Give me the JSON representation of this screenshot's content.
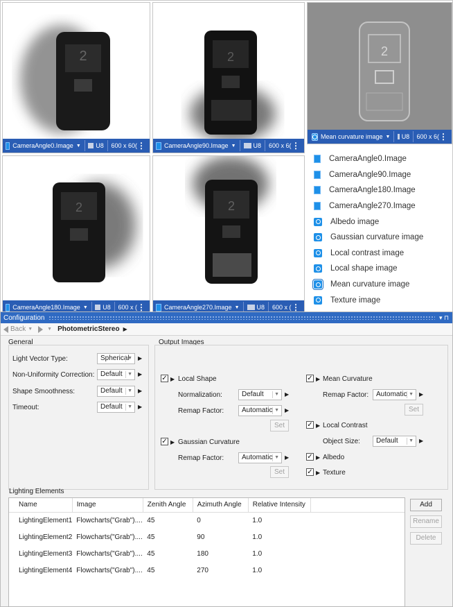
{
  "panes": [
    {
      "image": "CameraAngle0.Image",
      "type": "U8",
      "size": "600 x 60("
    },
    {
      "image": "CameraAngle90.Image",
      "type": "U8",
      "size": "600 x 6("
    },
    {
      "image": "Mean curvature image",
      "type": "U8",
      "size": "600 x 6("
    },
    {
      "image": "CameraAngle180.Image",
      "type": "U8",
      "size": "600 x ("
    },
    {
      "image": "CameraAngle270.Image",
      "type": "U8",
      "size": "600 x ("
    }
  ],
  "image_list": [
    {
      "label": "CameraAngle0.Image",
      "icon": "camera-image-icon"
    },
    {
      "label": "CameraAngle90.Image",
      "icon": "camera-image-icon"
    },
    {
      "label": "CameraAngle180.Image",
      "icon": "camera-image-icon"
    },
    {
      "label": "CameraAngle270.Image",
      "icon": "camera-image-icon"
    },
    {
      "label": "Albedo image",
      "icon": "computed-image-icon"
    },
    {
      "label": "Gaussian curvature image",
      "icon": "computed-image-icon"
    },
    {
      "label": "Local contrast image",
      "icon": "computed-image-icon"
    },
    {
      "label": "Local shape image",
      "icon": "computed-image-icon"
    },
    {
      "label": "Mean curvature image",
      "icon": "computed-image-icon",
      "selected": true
    },
    {
      "label": "Texture image",
      "icon": "computed-image-icon"
    }
  ],
  "config": {
    "title": "Configuration",
    "title_controls": "▾ ⊓",
    "nav": {
      "back": "Back",
      "breadcrumb": "PhotometricStereo"
    },
    "general": {
      "title": "General",
      "fields": [
        {
          "label": "Light Vector Type:",
          "value": "Spherical"
        },
        {
          "label": "Non-Uniformity Correction:",
          "value": "Default"
        },
        {
          "label": "Shape Smoothness:",
          "value": "Default"
        },
        {
          "label": "Timeout:",
          "value": "Default"
        }
      ]
    },
    "outputs": {
      "title": "Output Images",
      "local_shape": {
        "label": "Local Shape",
        "checked": true,
        "normalization_label": "Normalization:",
        "normalization_value": "Default",
        "remap_label": "Remap Factor:",
        "remap_value": "Automatic",
        "set": "Set"
      },
      "gaussian_curvature": {
        "label": "Gaussian Curvature",
        "checked": true,
        "remap_label": "Remap Factor:",
        "remap_value": "Automatic",
        "set": "Set"
      },
      "mean_curvature": {
        "label": "Mean Curvature",
        "checked": true,
        "remap_label": "Remap Factor:",
        "remap_value": "Automatic",
        "set": "Set"
      },
      "local_contrast": {
        "label": "Local Contrast",
        "checked": true,
        "object_size_label": "Object Size:",
        "object_size_value": "Default"
      },
      "albedo": {
        "label": "Albedo",
        "checked": true
      },
      "texture": {
        "label": "Texture",
        "checked": true
      }
    },
    "lighting": {
      "title": "Lighting Elements",
      "columns": [
        "Name",
        "Image",
        "Zenith Angle",
        "Azimuth Angle",
        "Relative Intensity"
      ],
      "rows": [
        [
          "LightingElement1",
          "Flowcharts(\"Grab\")....",
          "45",
          "0",
          "1.0"
        ],
        [
          "LightingElement2",
          "Flowcharts(\"Grab\")....",
          "45",
          "90",
          "1.0"
        ],
        [
          "LightingElement3",
          "Flowcharts(\"Grab\")....",
          "45",
          "180",
          "1.0"
        ],
        [
          "LightingElement4",
          "Flowcharts(\"Grab\")....",
          "45",
          "270",
          "1.0"
        ]
      ],
      "buttons": {
        "add": "Add",
        "rename": "Rename",
        "delete": "Delete"
      }
    }
  },
  "colors": {
    "accent": "#2a5db4",
    "title_bar": "#2f6ac2",
    "icon_blue": "#1e90e8"
  }
}
